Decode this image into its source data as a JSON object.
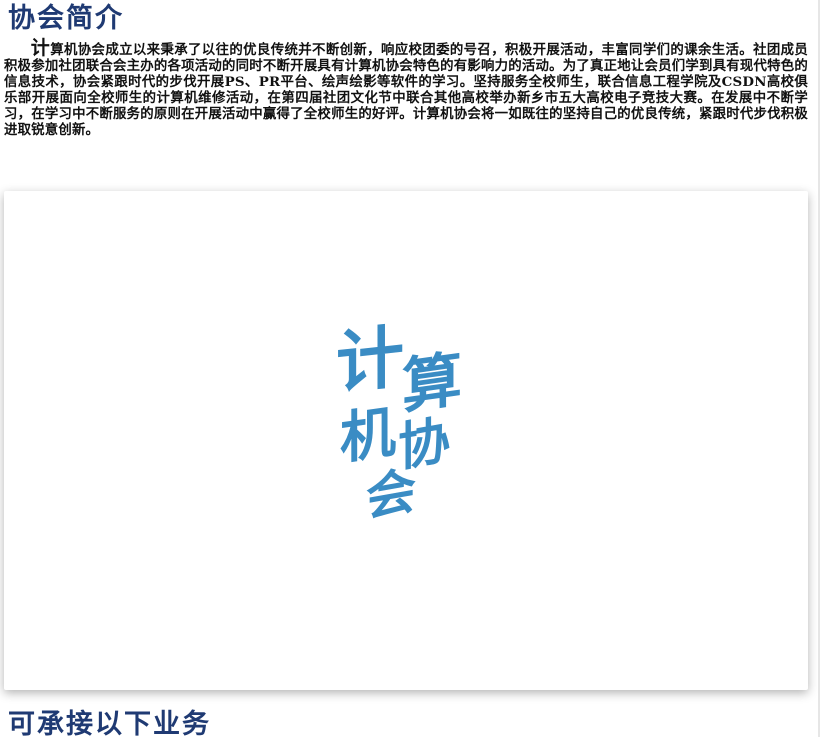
{
  "intro": {
    "title": "协会简介",
    "first_char": "计",
    "body": "算机协会成立以来秉承了以往的优良传统并不断创新，响应校团委的号召，积极开展活动，丰富同学们的课余生活。社团成员积极参加社团联合会主办的各项活动的同时不断开展具有计算机协会特色的有影响力的活动。为了真正地让会员们学到具有现代特色的信息技术，协会紧跟时代的步伐开展PS、PR平台、绘声绘影等软件的学习。坚持服务全校师生，联合信息工程学院及CSDN高校俱乐部开展面向全校师生的计算机维修活动，在第四届社团文化节中联合其他高校举办新乡市五大高校电子竞技大赛。在发展中不断学习，在学习中不断服务的原则在开展活动中赢得了全校师生的好评。计算机协会将一如既往的坚持自己的优良传统，紧跟时代步伐积极进取锐意创新。"
  },
  "logo": {
    "chars": [
      "计",
      "算",
      "机",
      "协",
      "会"
    ],
    "color": "#3a8cc4"
  },
  "services": {
    "title": "可承接以下业务"
  },
  "colors": {
    "heading": "#1f3a73",
    "text": "#111111"
  }
}
